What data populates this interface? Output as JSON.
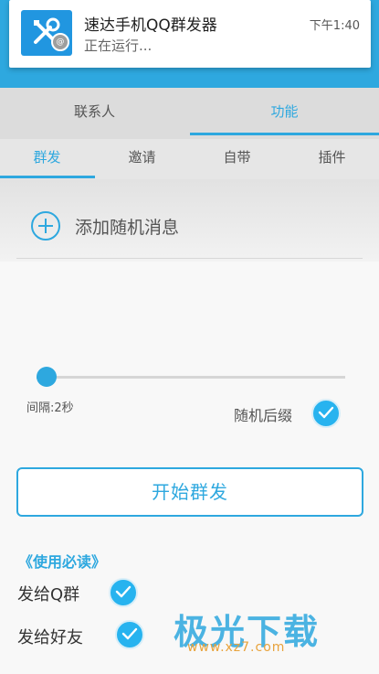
{
  "notification": {
    "title": "速达手机QQ群发器",
    "subtitle": "正在运行...",
    "time": "下午1:40",
    "badge": "@"
  },
  "tabs_primary": [
    {
      "label": "联系人",
      "active": false
    },
    {
      "label": "功能",
      "active": true
    }
  ],
  "tabs_secondary": [
    {
      "label": "群发",
      "active": true
    },
    {
      "label": "邀请",
      "active": false
    },
    {
      "label": "自带",
      "active": false
    },
    {
      "label": "插件",
      "active": false
    }
  ],
  "add_random_message": {
    "label": "添加随机消息"
  },
  "interval_slider": {
    "value": 2,
    "min": 0,
    "max": 60,
    "label": "间隔:2秒"
  },
  "random_suffix": {
    "label": "随机后缀",
    "checked": true
  },
  "start_button": {
    "label": "开始群发"
  },
  "readme_link": {
    "label": "《使用必读》"
  },
  "options": [
    {
      "label": "发给Q群",
      "checked": true
    },
    {
      "label": "发给好友",
      "checked": true
    }
  ],
  "watermark": {
    "text": "极光下载",
    "url": "www.xz7.com"
  },
  "colors": {
    "accent": "#2ea8df",
    "check": "#27b3ef"
  }
}
